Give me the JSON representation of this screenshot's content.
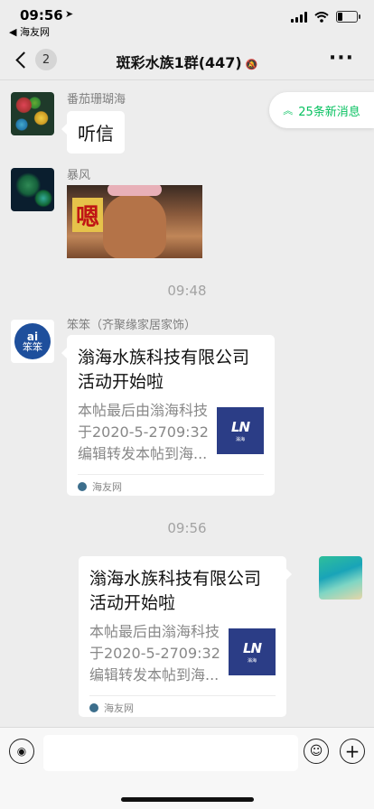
{
  "status_bar": {
    "time": "09:56",
    "back_app": "◀ 海友网"
  },
  "nav": {
    "badge": "2",
    "title": "斑彩水族1群(447)"
  },
  "new_messages": "25条新消息",
  "messages": [
    {
      "sender": "番茄珊瑚海",
      "text": "听信"
    },
    {
      "sender": "暴风",
      "sticker_text": "嗯"
    },
    {
      "timestamp": "09:48"
    },
    {
      "sender": "笨笨（齐聚缘家居家饰）",
      "card": {
        "title": "滃海水族科技有限公司活动开始啦",
        "desc": "本帖最后由滃海科技于2020-5-2709:32编辑转发本帖到海...",
        "source": "海友网",
        "thumb_mark": "LN",
        "thumb_sub": "滃海"
      }
    },
    {
      "timestamp": "09:56"
    },
    {
      "self": true,
      "card": {
        "title": "滃海水族科技有限公司活动开始啦",
        "desc": "本帖最后由滃海科技于2020-5-2709:32编辑转发本帖到海...",
        "source": "海友网",
        "thumb_mark": "LN",
        "thumb_sub": "滃海"
      }
    }
  ],
  "avatar_texts": {
    "bb_top": "ai",
    "bb_bottom": "笨笨"
  },
  "colors": {
    "accent_green": "#07c160",
    "thumb_blue": "#2b3d86"
  },
  "icons": [
    "location-arrow-icon",
    "signal-icon",
    "wifi-icon",
    "battery-icon",
    "chevron-left-icon",
    "mute-bell-icon",
    "more-icon",
    "double-up-arrow-icon",
    "voice-icon",
    "emoji-icon",
    "plus-icon"
  ]
}
